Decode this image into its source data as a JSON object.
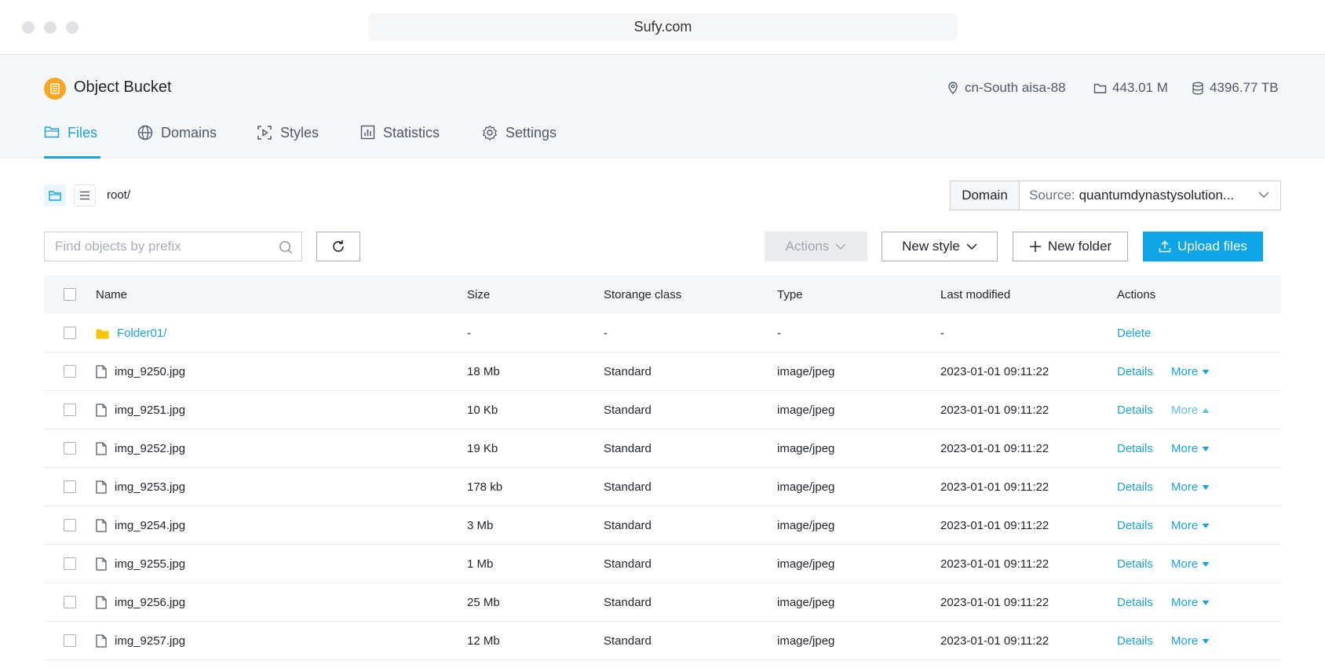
{
  "browser": {
    "url": "Sufy.com"
  },
  "bucket": {
    "title": "Object Bucket",
    "region": "cn-South aisa-88",
    "objects": "443.01 M",
    "storage": "4396.77 TB"
  },
  "tabs": [
    {
      "label": "Files",
      "icon": "folder-icon",
      "active": true
    },
    {
      "label": "Domains",
      "icon": "globe-icon"
    },
    {
      "label": "Styles",
      "icon": "media-frame-icon"
    },
    {
      "label": "Statistics",
      "icon": "bar-chart-icon"
    },
    {
      "label": "Settings",
      "icon": "gear-icon"
    }
  ],
  "breadcrumb": {
    "path": "root/"
  },
  "domain": {
    "label": "Domain",
    "source_prefix": "Source:",
    "source_value": "quantumdynastysolution..."
  },
  "toolbar": {
    "search_placeholder": "Find objects by prefix",
    "actions_label": "Actions",
    "new_style_label": "New style",
    "new_folder_label": "New folder",
    "upload_label": "Upload files"
  },
  "colors": {
    "accent": "#1aa3d9",
    "primary_button": "#0ea5e9",
    "folder": "#f7c600",
    "bucket_logo": "#f5a623"
  },
  "table": {
    "headers": {
      "name": "Name",
      "size": "Size",
      "storage_class": "Storange class",
      "type": "Type",
      "last_modified": "Last modified",
      "actions": "Actions"
    },
    "folder_row": {
      "name": "Folder01/",
      "size": "-",
      "storage_class": "-",
      "type": "-",
      "last_modified": "-",
      "action": "Delete"
    },
    "details_label": "Details",
    "more_label": "More",
    "rows": [
      {
        "name": "img_9250.jpg",
        "size": "18 Mb",
        "storage_class": "Standard",
        "type": "image/jpeg",
        "last_modified": "2023-01-01 09:11:22"
      },
      {
        "name": "img_9251.jpg",
        "size": "10 Kb",
        "storage_class": "Standard",
        "type": "image/jpeg",
        "last_modified": "2023-01-01 09:11:22"
      },
      {
        "name": "img_9252.jpg",
        "size": "19 Kb",
        "storage_class": "Standard",
        "type": "image/jpeg",
        "last_modified": "2023-01-01 09:11:22"
      },
      {
        "name": "img_9253.jpg",
        "size": "178 kb",
        "storage_class": "Standard",
        "type": "image/jpeg",
        "last_modified": "2023-01-01 09:11:22"
      },
      {
        "name": "img_9254.jpg",
        "size": "3 Mb",
        "storage_class": "Standard",
        "type": "image/jpeg",
        "last_modified": "2023-01-01 09:11:22"
      },
      {
        "name": "img_9255.jpg",
        "size": "1 Mb",
        "storage_class": "Standard",
        "type": "image/jpeg",
        "last_modified": "2023-01-01 09:11:22"
      },
      {
        "name": "img_9256.jpg",
        "size": "25 Mb",
        "storage_class": "Standard",
        "type": "image/jpeg",
        "last_modified": "2023-01-01 09:11:22"
      },
      {
        "name": "img_9257.jpg",
        "size": "12 Mb",
        "storage_class": "Standard",
        "type": "image/jpeg",
        "last_modified": "2023-01-01 09:11:22"
      }
    ]
  }
}
